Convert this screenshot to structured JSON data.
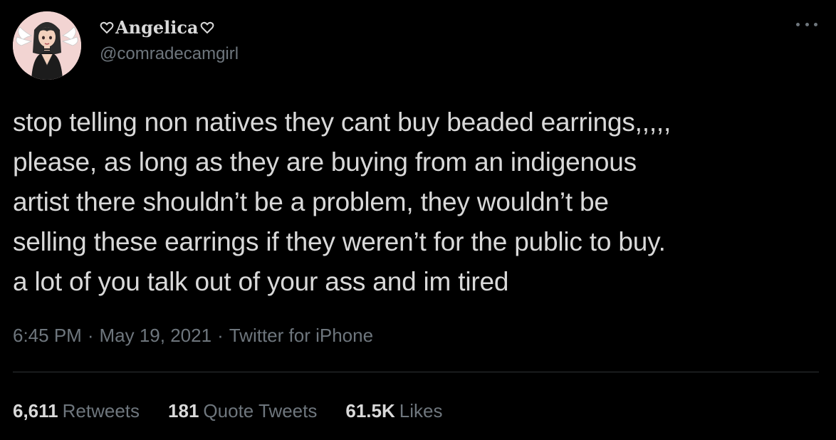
{
  "author": {
    "display_name": "Angelica",
    "handle": "@comradecamgirl",
    "avatar_icon": "anime-girl-with-wings-avatar",
    "avatar_bg": "#f2d4d2"
  },
  "more_icon": "ellipsis-icon",
  "tweet": {
    "lines": [
      "stop telling non natives they cant buy beaded earrings,,,,,",
      "please, as long as they are buying from an indigenous",
      "artist there shouldn’t be a problem, they wouldn’t be",
      "selling these earrings if they weren’t for the public to buy.",
      "a lot of you talk out of your ass and im tired"
    ]
  },
  "meta": {
    "time": "6:45 PM",
    "separator": "·",
    "date": "May 19, 2021",
    "source": "Twitter for iPhone"
  },
  "stats": {
    "retweets": {
      "count": "6,611",
      "label": "Retweets"
    },
    "quotes": {
      "count": "181",
      "label": "Quote Tweets"
    },
    "likes": {
      "count": "61.5K",
      "label": "Likes"
    }
  },
  "colors": {
    "background": "#000000",
    "text": "#d9d9d9",
    "secondary": "#6e767d",
    "divider": "#2f3336"
  }
}
